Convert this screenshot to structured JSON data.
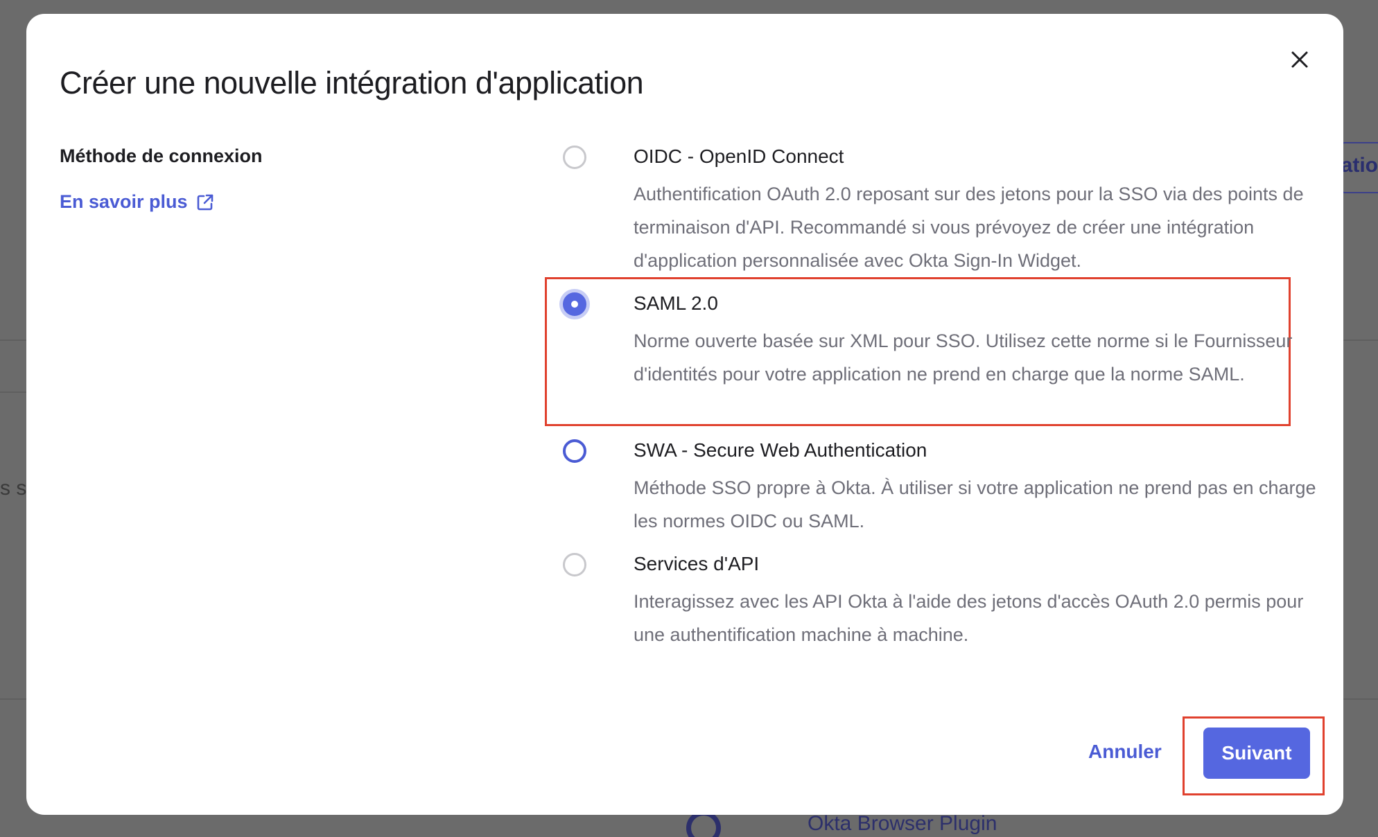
{
  "background": {
    "right_tab_fragment": "catio",
    "left_text_fragment": "s se",
    "bottom_item_label": "Okta Browser Plugin"
  },
  "modal": {
    "title": "Créer une nouvelle intégration d'application",
    "close_icon": "close-icon",
    "section_label": "Méthode de connexion",
    "learn_more": "En savoir plus",
    "learn_more_icon": "external-link-icon",
    "options": [
      {
        "title": "OIDC - OpenID Connect",
        "description": "Authentification OAuth 2.0 reposant sur des jetons pour la SSO via des points de terminaison d'API. Recommandé si vous prévoyez de créer une intégration d'application personnalisée avec Okta Sign-In Widget.",
        "state": "unchecked"
      },
      {
        "title": "SAML 2.0",
        "description": "Norme ouverte basée sur XML pour SSO. Utilisez cette norme si le Fournisseur d'identités pour votre application ne prend en charge que la norme SAML.",
        "state": "checked"
      },
      {
        "title": "SWA - Secure Web Authentication",
        "description": "Méthode SSO propre à Okta. À utiliser si votre application ne prend pas en charge les normes OIDC ou SAML.",
        "state": "focus"
      },
      {
        "title": "Services d'API",
        "description": "Interagissez avec les API Okta à l'aide des jetons d'accès OAuth 2.0 permis pour une authentification machine à machine.",
        "state": "unchecked"
      }
    ],
    "cancel_label": "Annuler",
    "next_label": "Suivant"
  },
  "colors": {
    "accent": "#5567e0",
    "link": "#4a5bd4",
    "highlight": "#e0412e",
    "overlay": "#6b6b6b"
  }
}
